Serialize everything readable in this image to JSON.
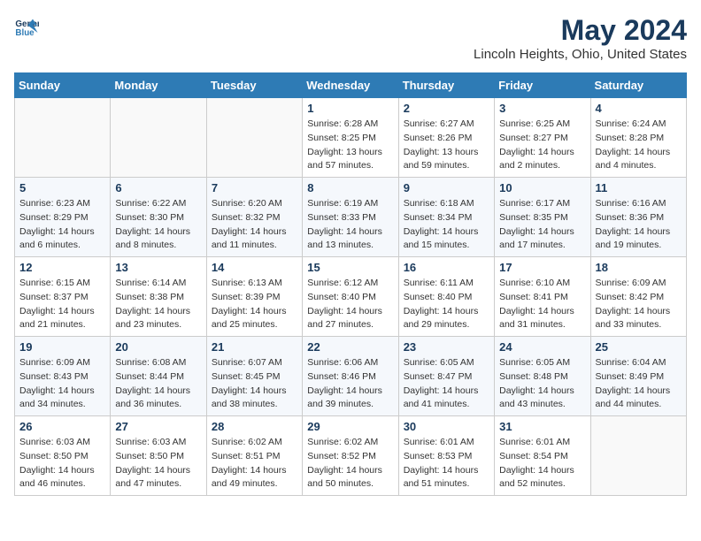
{
  "header": {
    "logo_line1": "General",
    "logo_line2": "Blue",
    "month_year": "May 2024",
    "location": "Lincoln Heights, Ohio, United States"
  },
  "days_of_week": [
    "Sunday",
    "Monday",
    "Tuesday",
    "Wednesday",
    "Thursday",
    "Friday",
    "Saturday"
  ],
  "weeks": [
    [
      {
        "day": "",
        "info": ""
      },
      {
        "day": "",
        "info": ""
      },
      {
        "day": "",
        "info": ""
      },
      {
        "day": "1",
        "sunrise": "6:28 AM",
        "sunset": "8:25 PM",
        "daylight": "13 hours and 57 minutes."
      },
      {
        "day": "2",
        "sunrise": "6:27 AM",
        "sunset": "8:26 PM",
        "daylight": "13 hours and 59 minutes."
      },
      {
        "day": "3",
        "sunrise": "6:25 AM",
        "sunset": "8:27 PM",
        "daylight": "14 hours and 2 minutes."
      },
      {
        "day": "4",
        "sunrise": "6:24 AM",
        "sunset": "8:28 PM",
        "daylight": "14 hours and 4 minutes."
      }
    ],
    [
      {
        "day": "5",
        "sunrise": "6:23 AM",
        "sunset": "8:29 PM",
        "daylight": "14 hours and 6 minutes."
      },
      {
        "day": "6",
        "sunrise": "6:22 AM",
        "sunset": "8:30 PM",
        "daylight": "14 hours and 8 minutes."
      },
      {
        "day": "7",
        "sunrise": "6:20 AM",
        "sunset": "8:32 PM",
        "daylight": "14 hours and 11 minutes."
      },
      {
        "day": "8",
        "sunrise": "6:19 AM",
        "sunset": "8:33 PM",
        "daylight": "14 hours and 13 minutes."
      },
      {
        "day": "9",
        "sunrise": "6:18 AM",
        "sunset": "8:34 PM",
        "daylight": "14 hours and 15 minutes."
      },
      {
        "day": "10",
        "sunrise": "6:17 AM",
        "sunset": "8:35 PM",
        "daylight": "14 hours and 17 minutes."
      },
      {
        "day": "11",
        "sunrise": "6:16 AM",
        "sunset": "8:36 PM",
        "daylight": "14 hours and 19 minutes."
      }
    ],
    [
      {
        "day": "12",
        "sunrise": "6:15 AM",
        "sunset": "8:37 PM",
        "daylight": "14 hours and 21 minutes."
      },
      {
        "day": "13",
        "sunrise": "6:14 AM",
        "sunset": "8:38 PM",
        "daylight": "14 hours and 23 minutes."
      },
      {
        "day": "14",
        "sunrise": "6:13 AM",
        "sunset": "8:39 PM",
        "daylight": "14 hours and 25 minutes."
      },
      {
        "day": "15",
        "sunrise": "6:12 AM",
        "sunset": "8:40 PM",
        "daylight": "14 hours and 27 minutes."
      },
      {
        "day": "16",
        "sunrise": "6:11 AM",
        "sunset": "8:40 PM",
        "daylight": "14 hours and 29 minutes."
      },
      {
        "day": "17",
        "sunrise": "6:10 AM",
        "sunset": "8:41 PM",
        "daylight": "14 hours and 31 minutes."
      },
      {
        "day": "18",
        "sunrise": "6:09 AM",
        "sunset": "8:42 PM",
        "daylight": "14 hours and 33 minutes."
      }
    ],
    [
      {
        "day": "19",
        "sunrise": "6:09 AM",
        "sunset": "8:43 PM",
        "daylight": "14 hours and 34 minutes."
      },
      {
        "day": "20",
        "sunrise": "6:08 AM",
        "sunset": "8:44 PM",
        "daylight": "14 hours and 36 minutes."
      },
      {
        "day": "21",
        "sunrise": "6:07 AM",
        "sunset": "8:45 PM",
        "daylight": "14 hours and 38 minutes."
      },
      {
        "day": "22",
        "sunrise": "6:06 AM",
        "sunset": "8:46 PM",
        "daylight": "14 hours and 39 minutes."
      },
      {
        "day": "23",
        "sunrise": "6:05 AM",
        "sunset": "8:47 PM",
        "daylight": "14 hours and 41 minutes."
      },
      {
        "day": "24",
        "sunrise": "6:05 AM",
        "sunset": "8:48 PM",
        "daylight": "14 hours and 43 minutes."
      },
      {
        "day": "25",
        "sunrise": "6:04 AM",
        "sunset": "8:49 PM",
        "daylight": "14 hours and 44 minutes."
      }
    ],
    [
      {
        "day": "26",
        "sunrise": "6:03 AM",
        "sunset": "8:50 PM",
        "daylight": "14 hours and 46 minutes."
      },
      {
        "day": "27",
        "sunrise": "6:03 AM",
        "sunset": "8:50 PM",
        "daylight": "14 hours and 47 minutes."
      },
      {
        "day": "28",
        "sunrise": "6:02 AM",
        "sunset": "8:51 PM",
        "daylight": "14 hours and 49 minutes."
      },
      {
        "day": "29",
        "sunrise": "6:02 AM",
        "sunset": "8:52 PM",
        "daylight": "14 hours and 50 minutes."
      },
      {
        "day": "30",
        "sunrise": "6:01 AM",
        "sunset": "8:53 PM",
        "daylight": "14 hours and 51 minutes."
      },
      {
        "day": "31",
        "sunrise": "6:01 AM",
        "sunset": "8:54 PM",
        "daylight": "14 hours and 52 minutes."
      },
      {
        "day": "",
        "info": ""
      }
    ]
  ],
  "labels": {
    "sunrise": "Sunrise:",
    "sunset": "Sunset:",
    "daylight": "Daylight:"
  }
}
